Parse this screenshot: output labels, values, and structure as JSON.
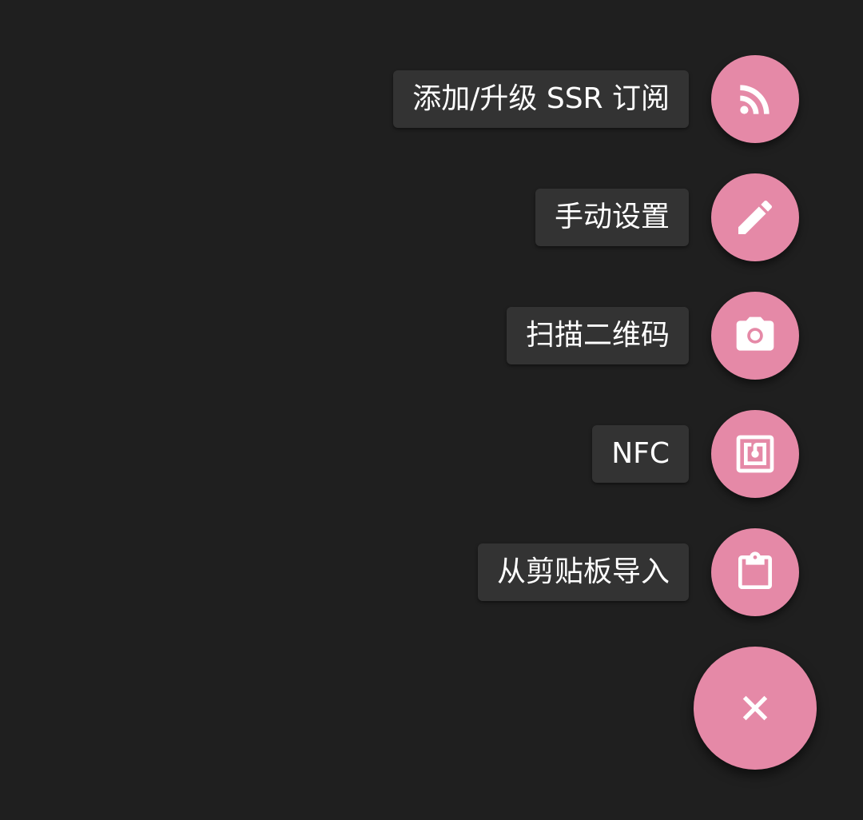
{
  "colors": {
    "background": "#1f1f1f",
    "fab": "#e589a7",
    "label_bg": "#333333",
    "label_text": "#ffffff"
  },
  "menu": {
    "items": [
      {
        "label": "添加/升级 SSR 订阅",
        "icon": "rss-icon"
      },
      {
        "label": "手动设置",
        "icon": "pencil-icon"
      },
      {
        "label": "扫描二维码",
        "icon": "camera-icon"
      },
      {
        "label": "NFC",
        "icon": "nfc-icon"
      },
      {
        "label": "从剪贴板导入",
        "icon": "clipboard-icon"
      }
    ],
    "main_button_icon": "close-icon"
  }
}
